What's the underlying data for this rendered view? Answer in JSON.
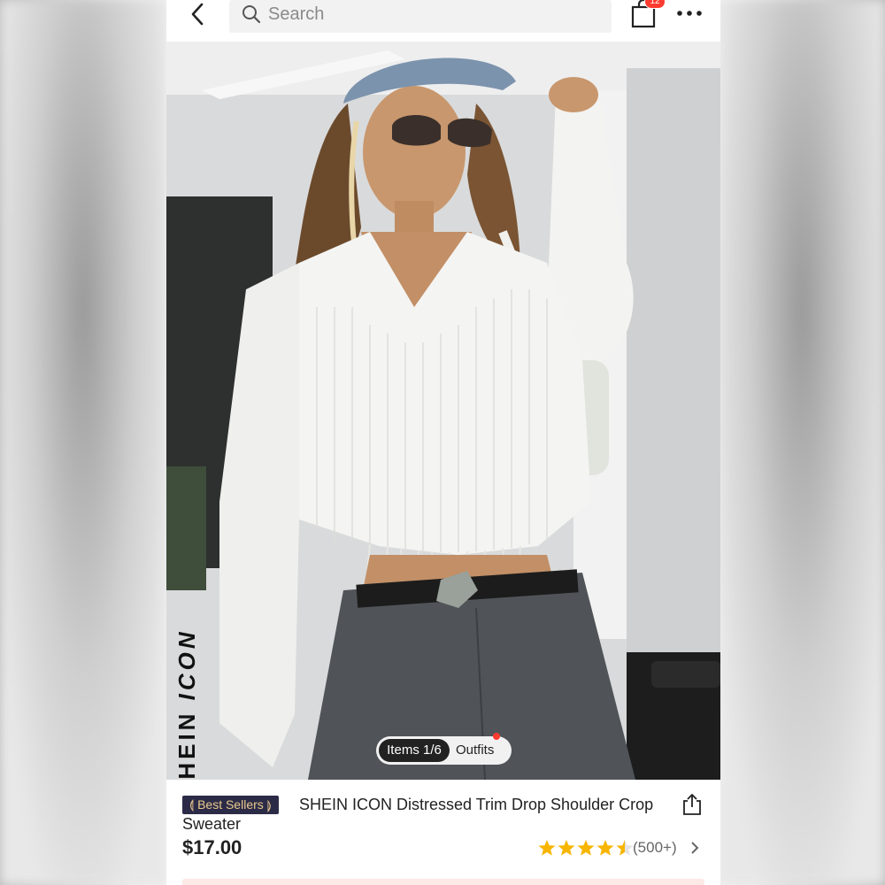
{
  "header": {
    "search_placeholder": "Search",
    "cart_count": "12"
  },
  "hero": {
    "brand_logo": "SHEIN ICON",
    "pager_items": "Items 1/6",
    "pager_outfits": "Outfits"
  },
  "product": {
    "badge": "⟬ Best Sellers ⟭",
    "title": "SHEIN ICON Distressed Trim Drop Shoulder Crop Sweater",
    "price": "$17.00",
    "rating": 4.5,
    "rating_count": "(500+)"
  },
  "colors": {
    "accent_red": "#fe3b30",
    "badge_bg": "#2c2b47",
    "badge_text": "#e9c98e",
    "star": "#f7b500"
  },
  "icons": [
    "back-arrow-icon",
    "search-icon",
    "shopping-bag-icon",
    "more-icon",
    "share-icon",
    "star-icon",
    "chevron-right-icon"
  ]
}
